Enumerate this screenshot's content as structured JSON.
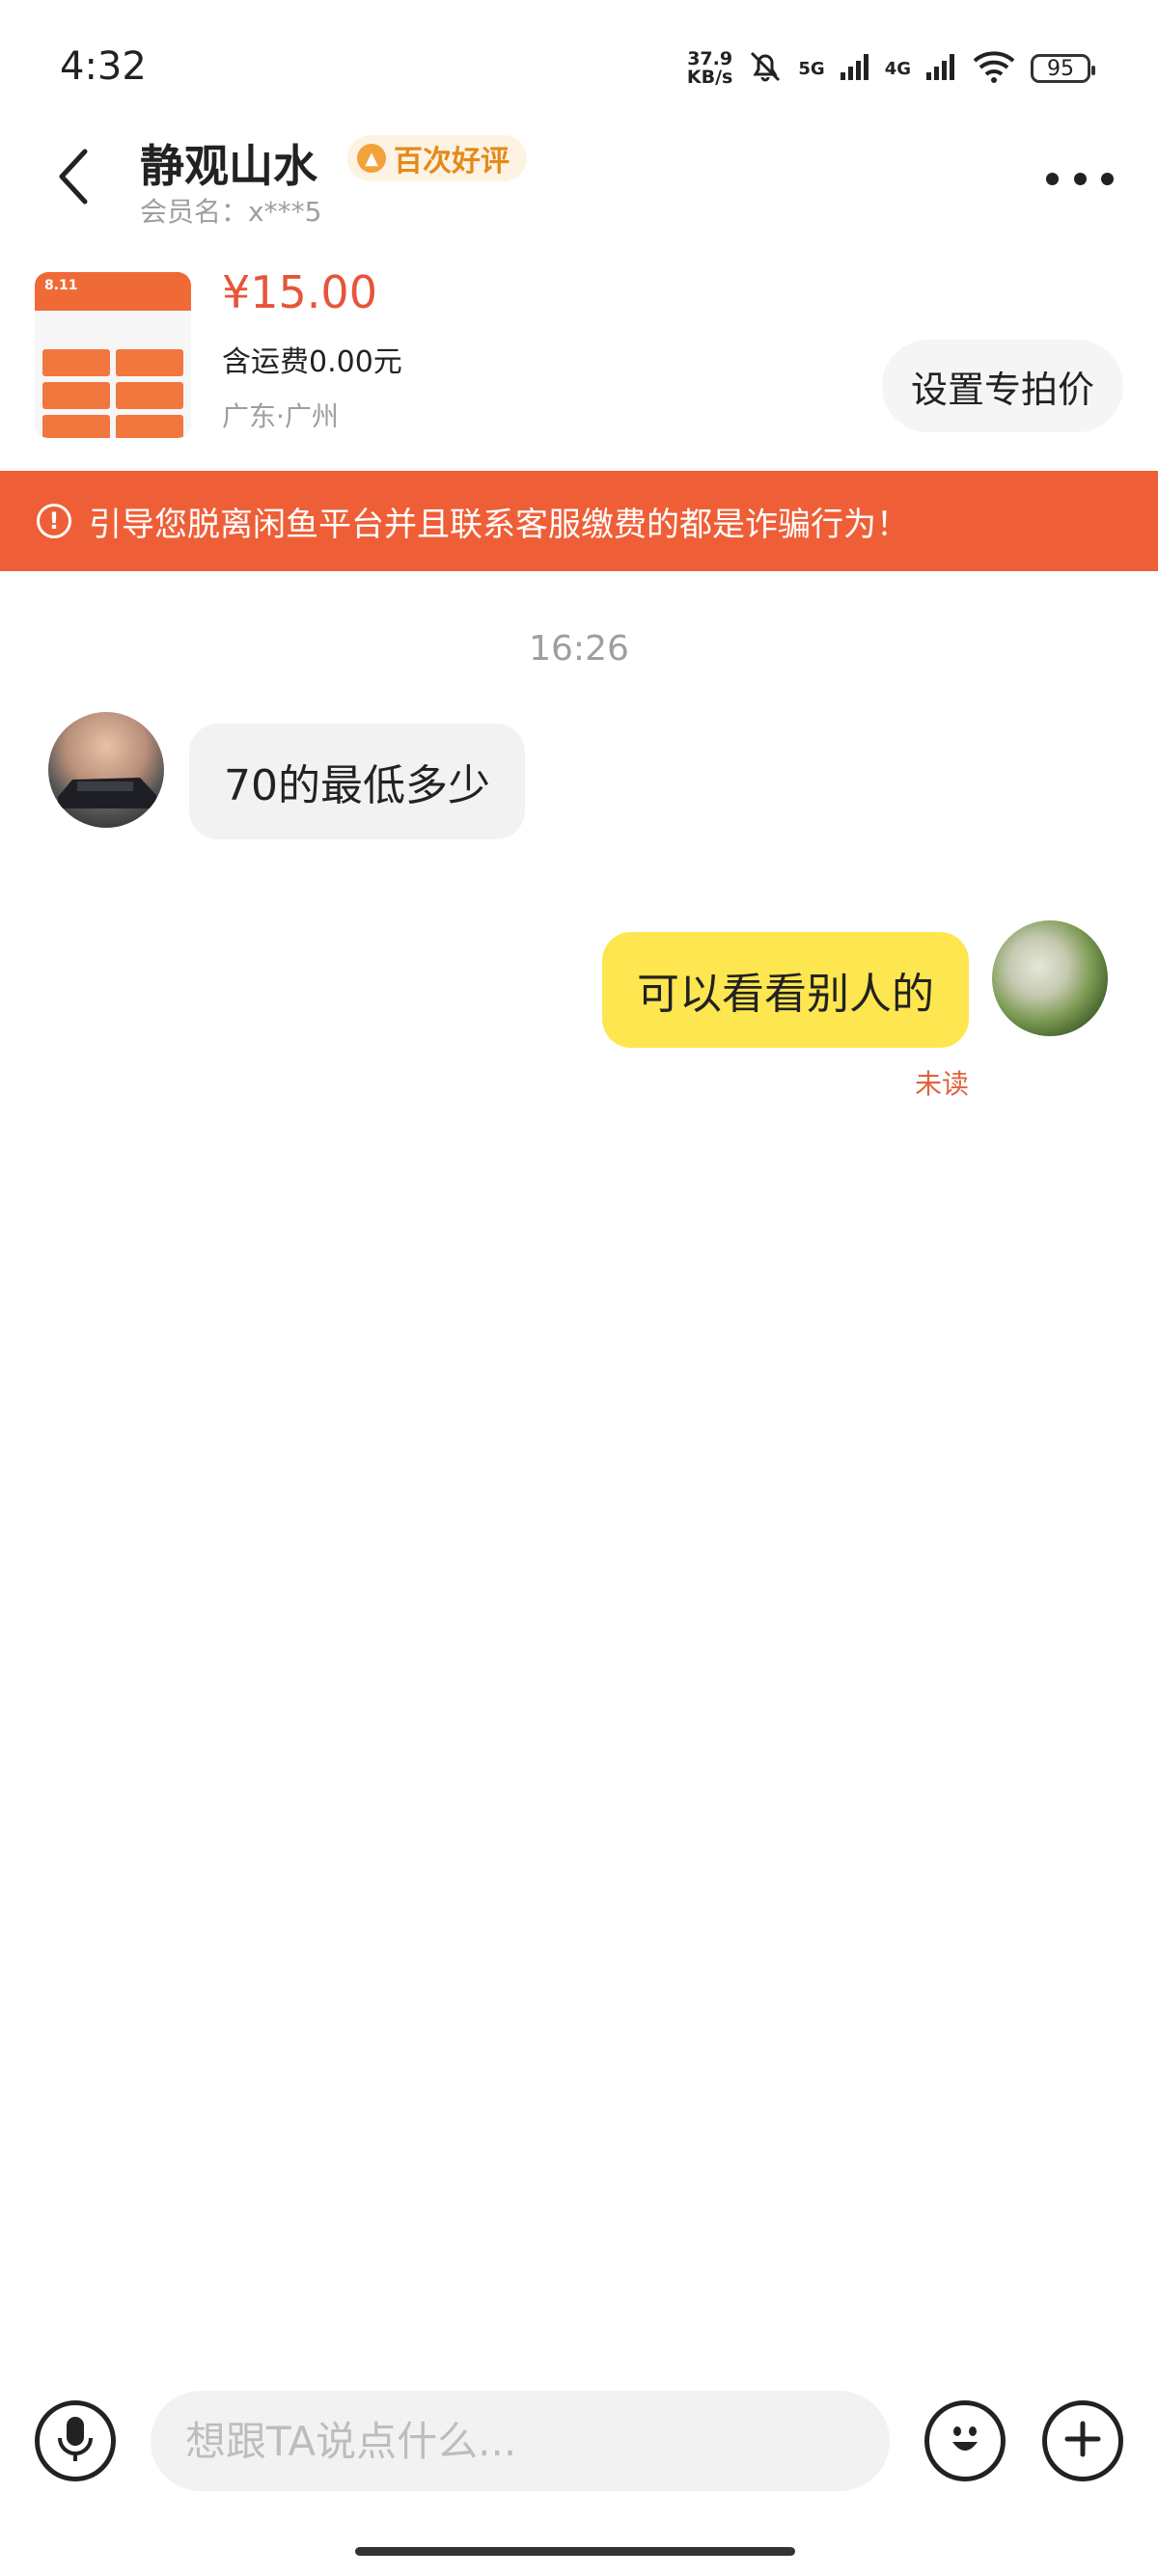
{
  "status_bar": {
    "time": "4:32",
    "net_speed_value": "37.9",
    "net_speed_unit": "KB/s",
    "signal1_label": "5G",
    "signal2_label": "4G",
    "battery": "95"
  },
  "header": {
    "contact_name": "静观山水",
    "badge": "百次好评",
    "member_name": "会员名：x***5"
  },
  "product": {
    "thumb_label": "8.11",
    "price": "¥15.00",
    "shipping": "含运费0.00元",
    "location": "广东·广州",
    "set_price_label": "设置专拍价"
  },
  "warning": {
    "text": "引导您脱离闲鱼平台并且联系客服缴费的都是诈骗行为！"
  },
  "chat": {
    "timestamp": "16:26",
    "messages": [
      {
        "side": "left",
        "text": "70的最低多少"
      },
      {
        "side": "right",
        "text": "可以看看别人的",
        "status": "未读"
      }
    ]
  },
  "input_bar": {
    "placeholder": "想跟TA说点什么..."
  },
  "colors": {
    "accent": "#ef5f37",
    "price": "#e65539",
    "my_bubble": "#fde64f",
    "other_bubble": "#f2f2f3",
    "badge_bg": "#fdf3e3",
    "badge_text": "#e48a1a"
  },
  "icons": {
    "back": "chevron-left-icon",
    "more": "more-dots-icon",
    "warning": "exclamation-circle-icon",
    "voice": "microphone-icon",
    "emoji": "smiley-icon",
    "add": "plus-icon"
  }
}
